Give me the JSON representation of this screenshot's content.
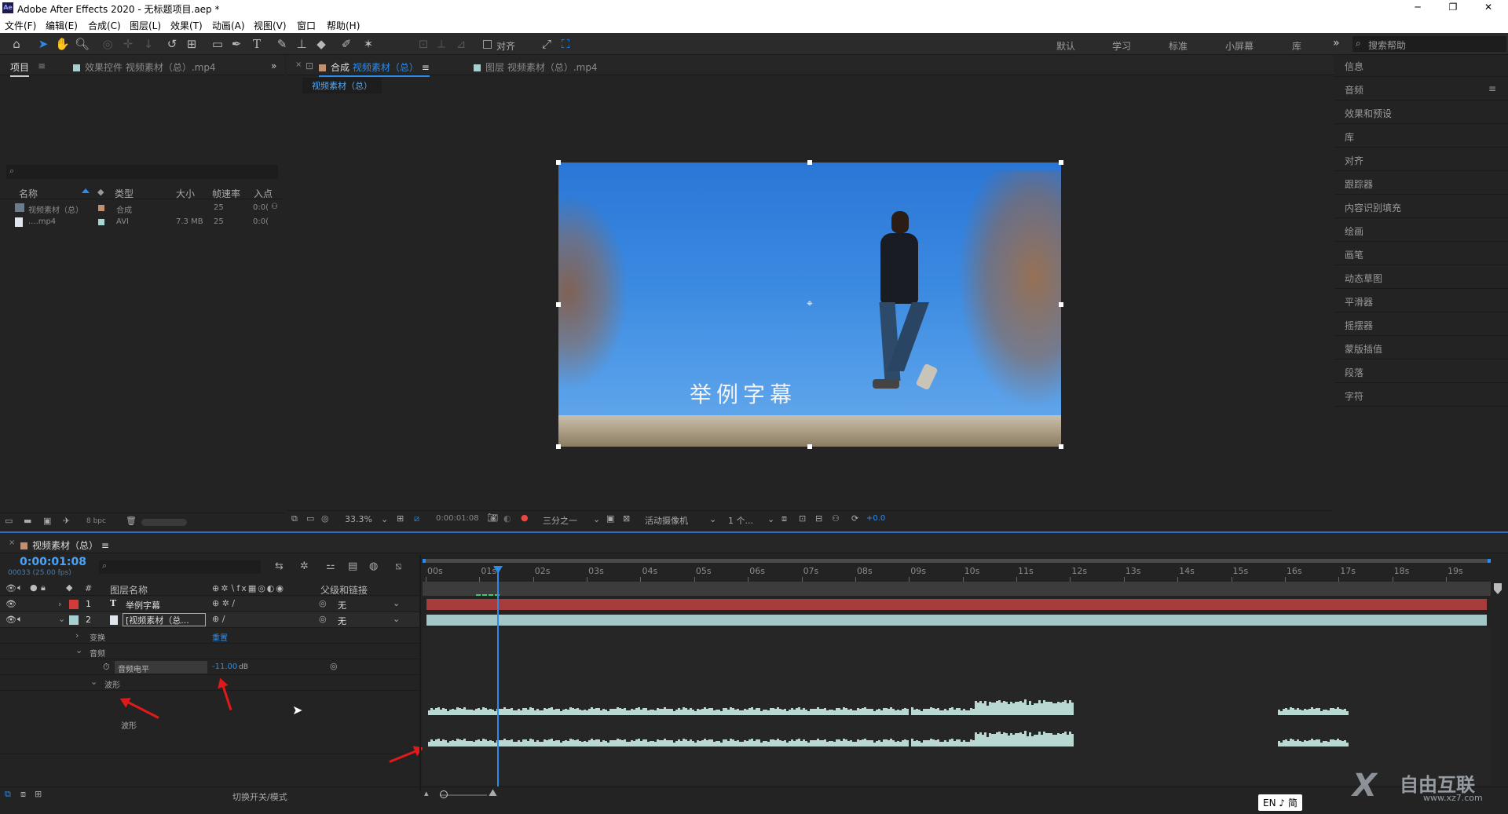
{
  "window": {
    "app_icon": "Ae",
    "title": "Adobe After Effects 2020 - 无标题项目.aep *",
    "minimize": "─",
    "restore": "❐",
    "close": "✕"
  },
  "menu": [
    "文件(F)",
    "编辑(E)",
    "合成(C)",
    "图层(L)",
    "效果(T)",
    "动画(A)",
    "视图(V)",
    "窗口",
    "帮助(H)"
  ],
  "toolbar": {
    "align_label": "对齐",
    "workspaces": [
      "默认",
      "学习",
      "标准",
      "小屏幕",
      "库"
    ],
    "more": "»",
    "search_placeholder": "搜索帮助"
  },
  "project": {
    "tab": "项目",
    "tab_menu": "≡",
    "effects_tab": "效果控件 视频素材（总）.mp4",
    "more": "»",
    "columns": [
      "名称",
      "类型",
      "大小",
      "帧速率",
      "入点"
    ],
    "items": [
      {
        "name": "视频素材（总）",
        "type": "合成",
        "size": "",
        "fps": "25",
        "in": "0:0(",
        "color": "#c09070"
      },
      {
        "name": "....mp4",
        "type": "AVI",
        "size": "7.3 MB",
        "fps": "25",
        "in": "0:0(",
        "color": "#a7d8d8"
      }
    ],
    "bpc": "8 bpc"
  },
  "comp_viewer": {
    "close": "×",
    "tab_prefix": "合成",
    "comp_name": "视频素材（总）",
    "tab_menu": "≡",
    "layer_tab": "图层 视频素材（总）.mp4",
    "subtab": "视频素材（总）",
    "subtitle": "举例字幕",
    "zoom": "33.3%",
    "time": "0:00:01:08",
    "resolution": "三分之一",
    "camera": "活动摄像机",
    "views": "1 个...",
    "exposure": "+0.0"
  },
  "right_panel": {
    "items": [
      "信息",
      "音频",
      "效果和预设",
      "库",
      "对齐",
      "跟踪器",
      "内容识别填充",
      "绘画",
      "画笔",
      "动态草图",
      "平滑器",
      "摇摆器",
      "蒙版插值",
      "段落",
      "字符"
    ],
    "menu": "≡"
  },
  "timeline": {
    "close": "×",
    "comp_name": "视频素材（总）",
    "tab_menu": "≡",
    "timecode": "0:00:01:08",
    "frame_info": "00033 (25.00 fps)",
    "headers": {
      "num": "#",
      "layer_name": "图层名称",
      "parent": "父级和链接"
    },
    "layers": [
      {
        "num": "1",
        "type_icon": "T",
        "name": "举例字幕",
        "parent": "无",
        "color": "#d33a3a"
      },
      {
        "num": "2",
        "name": "[视频素材（总...",
        "parent": "无",
        "color": "#a6cfcf"
      }
    ],
    "props": {
      "transform": "变换",
      "reset": "重置",
      "audio": "音频",
      "audio_level": "音频电平",
      "audio_value": "-11.00",
      "audio_unit": "dB",
      "waveform": "波形",
      "waveform_label": "波形"
    },
    "ruler": [
      "00s",
      "01s",
      "02s",
      "03s",
      "04s",
      "05s",
      "06s",
      "07s",
      "08s",
      "09s",
      "10s",
      "11s",
      "12s",
      "13s",
      "14s",
      "15s",
      "16s",
      "17s",
      "18s",
      "19s"
    ],
    "playhead": 1.32,
    "duration": 20,
    "footer": {
      "toggle": "切换开关/模式"
    }
  },
  "ime": "EN ♪ 简",
  "watermark": {
    "brand": "自由互联",
    "url": "www.xz7.com"
  },
  "colors": {
    "accent": "#2d8ceb",
    "label_red": "#d33a3a",
    "label_aqua": "#a6cfcf",
    "track_red": "#a83b3b",
    "track_aqua": "#a3c7c6",
    "arrow": "#e01a1a"
  }
}
